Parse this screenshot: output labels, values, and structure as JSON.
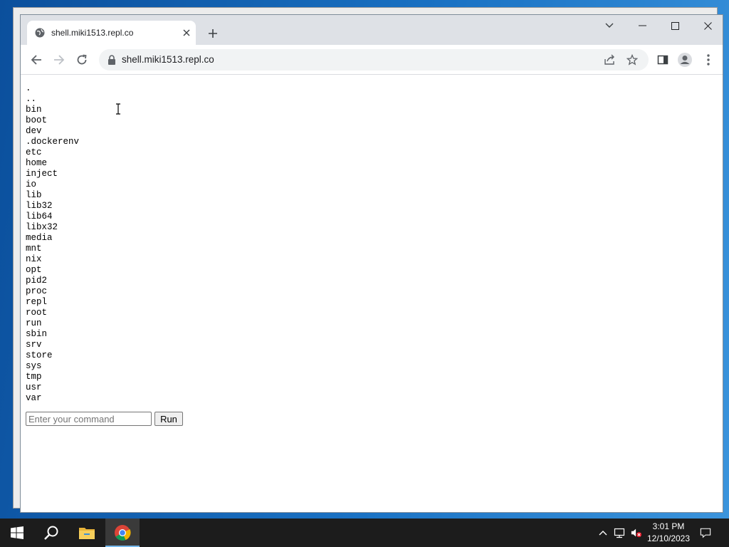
{
  "browser": {
    "tab": {
      "title": "shell.miki1513.repl.co"
    },
    "address": {
      "url": "shell.miki1513.repl.co"
    }
  },
  "page": {
    "listing": [
      ".",
      "..",
      "bin",
      "boot",
      "dev",
      ".dockerenv",
      "etc",
      "home",
      "inject",
      "io",
      "lib",
      "lib32",
      "lib64",
      "libx32",
      "media",
      "mnt",
      "nix",
      "opt",
      "pid2",
      "proc",
      "repl",
      "root",
      "run",
      "sbin",
      "srv",
      "store",
      "sys",
      "tmp",
      "usr",
      "var"
    ],
    "command": {
      "placeholder": "Enter your command",
      "value": "",
      "run_label": "Run"
    }
  },
  "taskbar": {
    "clock": {
      "time": "3:01 PM",
      "date": "12/10/2023"
    },
    "pinned": [
      "start-icon",
      "search-icon",
      "file-explorer-icon",
      "chrome-icon"
    ]
  },
  "colors": {
    "taskbar": "#1c1c1c",
    "tabstrip": "#dee1e6",
    "omnibox": "#f1f3f4",
    "accent": "#76b9ed"
  }
}
